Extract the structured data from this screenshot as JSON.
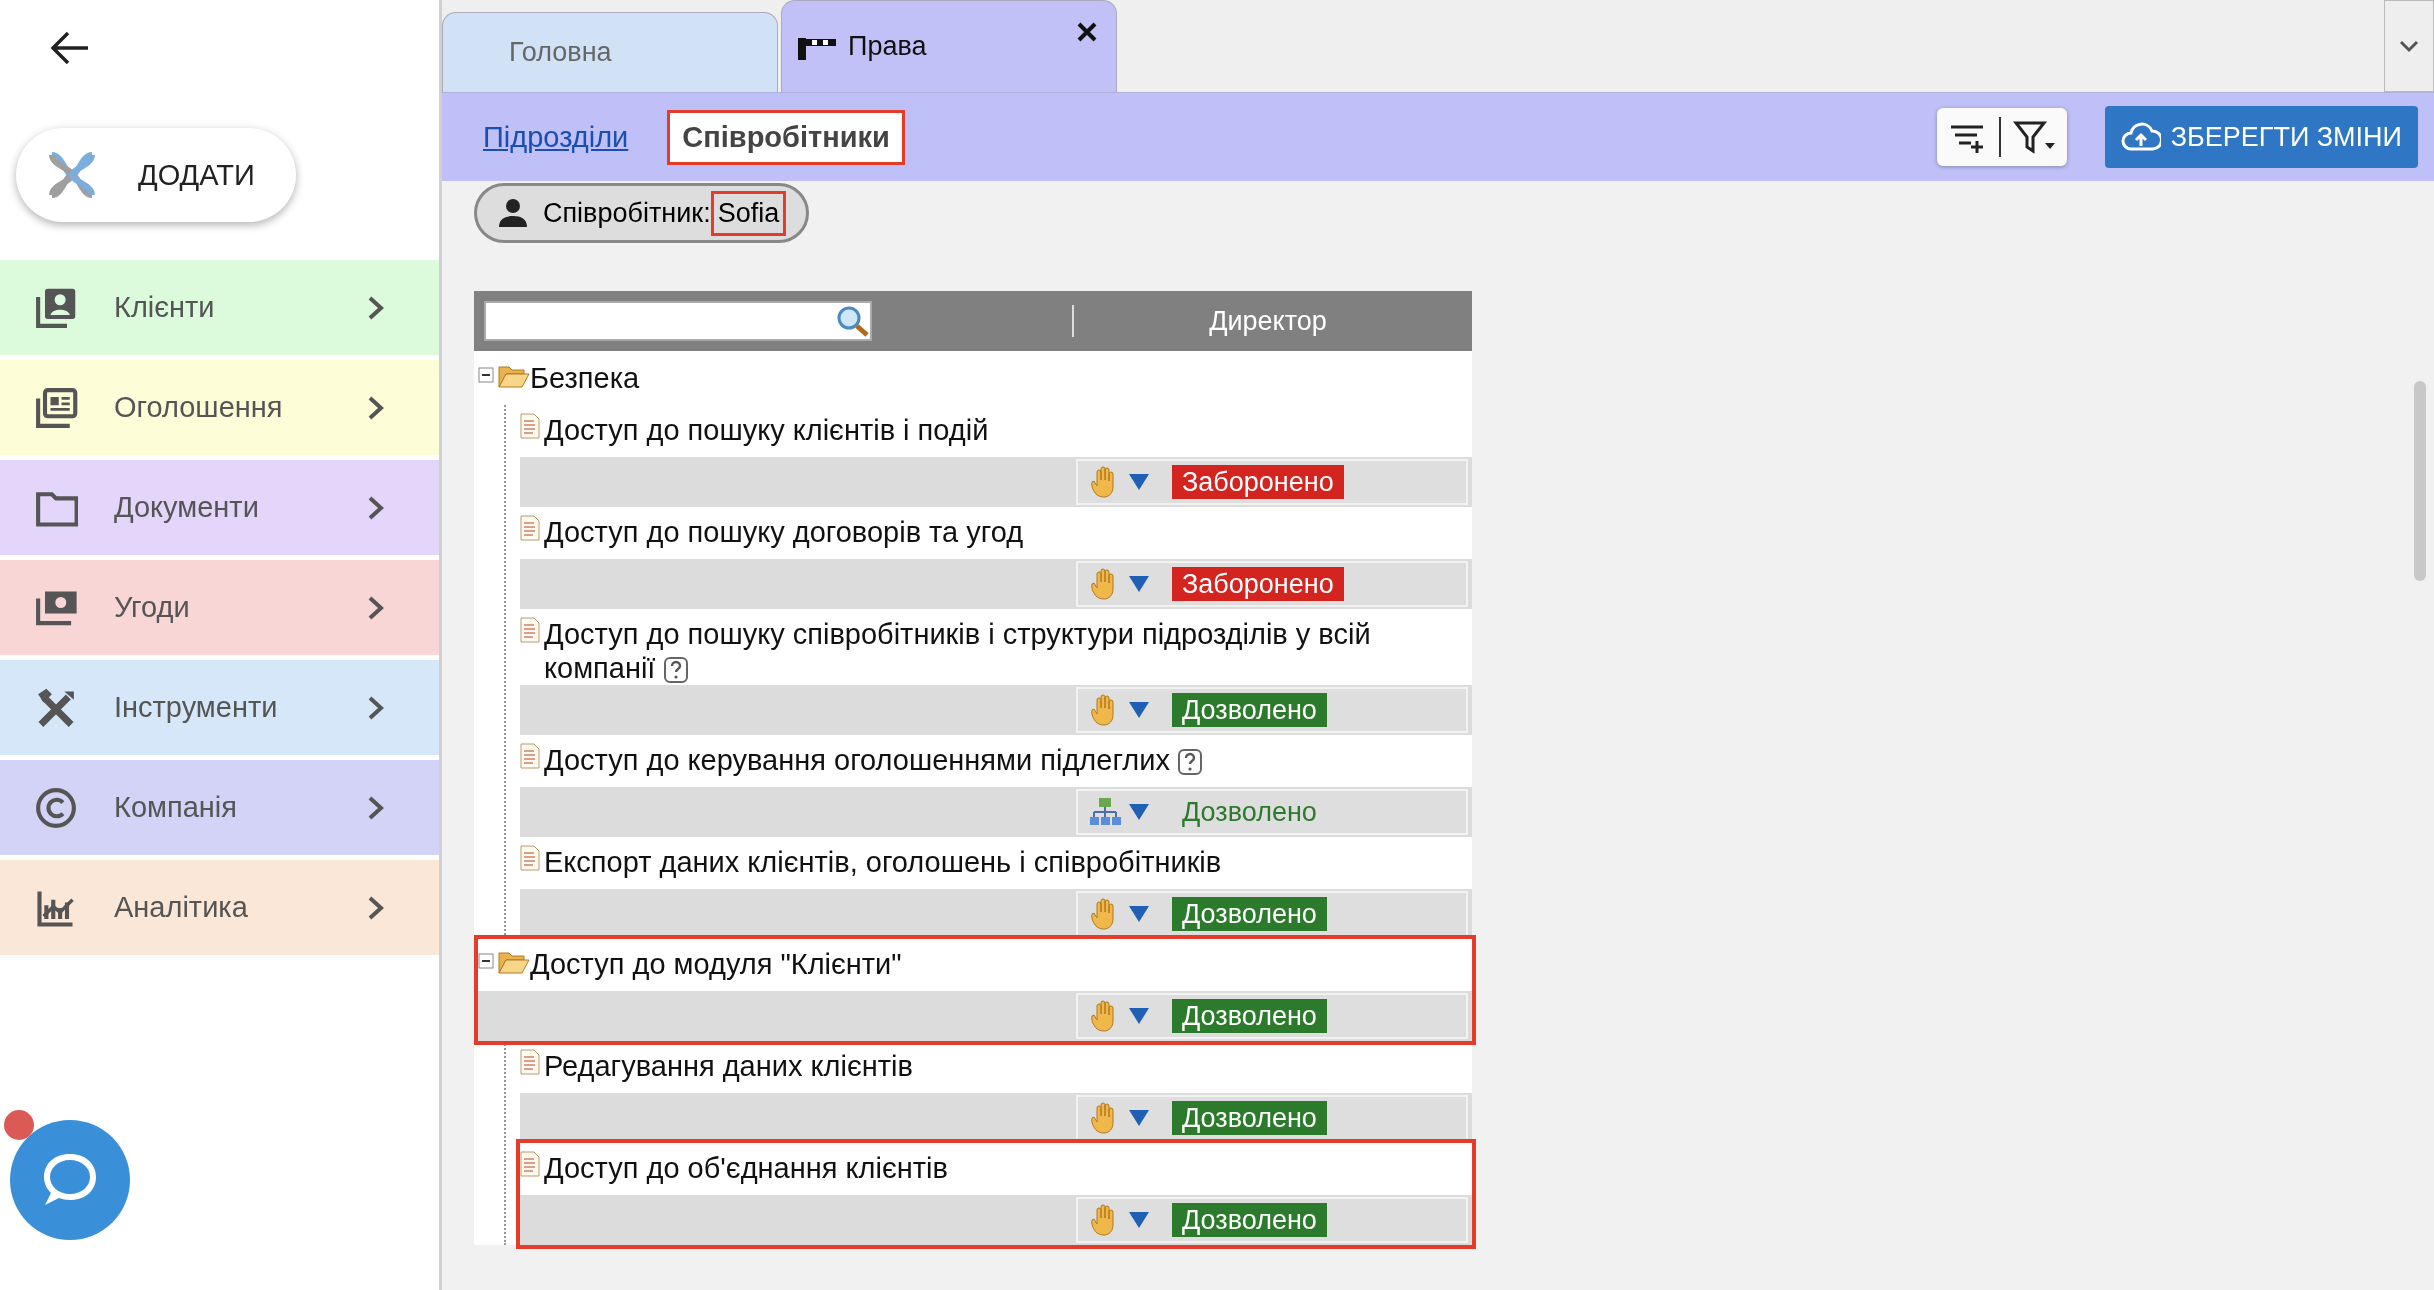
{
  "sidebar": {
    "add_button": {
      "label": "ДОДАТИ"
    },
    "items": [
      {
        "kind": "contacts",
        "label": "Клієнти",
        "color": "#dcfadc"
      },
      {
        "kind": "listings",
        "label": "Оголошення",
        "color": "#fdfdd7"
      },
      {
        "kind": "folder",
        "label": "Документи",
        "color": "#e4d5fb"
      },
      {
        "kind": "money",
        "label": "Угоди",
        "color": "#f8d6d6"
      },
      {
        "kind": "tools",
        "label": "Інструменти",
        "color": "#d7e7fa"
      },
      {
        "kind": "copyright",
        "label": "Компанія",
        "color": "#d3d3f7"
      },
      {
        "kind": "chart",
        "label": "Аналітика",
        "color": "#fbe7d7"
      }
    ],
    "chat": {
      "notification": true
    }
  },
  "tabs": [
    {
      "kind": "plain",
      "label": "Головна",
      "selected": false,
      "closable": false
    },
    {
      "kind": "barrier",
      "label": "Права",
      "selected": true,
      "closable": true
    }
  ],
  "subtabs": [
    {
      "label": "Підрозділи",
      "selected": false,
      "highlighted": false
    },
    {
      "label": "Співробітники",
      "selected": true,
      "highlighted": true
    }
  ],
  "save_button": {
    "label": "ЗБЕРЕГТИ ЗМІНИ"
  },
  "employee": {
    "label": "Співробітник:",
    "value": "Sofia",
    "highlighted": true
  },
  "tree": {
    "column": "Директор",
    "nodes": [
      {
        "label": "Безпека",
        "expanded": true,
        "highlighted": false,
        "children": [
          {
            "label": "Доступ до пошуку клієнтів і подій",
            "help": false,
            "highlighted": false,
            "permission": {
              "inherited": false,
              "allowed": false,
              "label": "Заборонено"
            }
          },
          {
            "label": "Доступ до пошуку договорів та угод",
            "help": false,
            "highlighted": false,
            "permission": {
              "inherited": false,
              "allowed": false,
              "label": "Заборонено"
            }
          },
          {
            "label": "Доступ до пошуку співробітників і структури підрозділів у всій компанії",
            "help": true,
            "highlighted": false,
            "permission": {
              "inherited": false,
              "allowed": true,
              "label": "Дозволено"
            }
          },
          {
            "label": "Доступ до керування оголошеннями підлеглих",
            "help": true,
            "highlighted": false,
            "permission": {
              "inherited": true,
              "allowed": true,
              "label": "Дозволено"
            }
          },
          {
            "label": "Експорт даних клієнтів, оголошень і співробітників",
            "help": false,
            "highlighted": false,
            "permission": {
              "inherited": false,
              "allowed": true,
              "label": "Дозволено"
            }
          }
        ]
      },
      {
        "label": "Доступ до модуля \"Клієнти\"",
        "expanded": true,
        "highlighted": true,
        "permission": {
          "inherited": false,
          "allowed": true,
          "label": "Дозволено"
        },
        "children": [
          {
            "label": "Редагування даних клієнтів",
            "help": false,
            "highlighted": false,
            "permission": {
              "inherited": false,
              "allowed": true,
              "label": "Дозволено"
            }
          },
          {
            "label": "Доступ до об'єднання клієнтів",
            "help": false,
            "highlighted": true,
            "permission": {
              "inherited": false,
              "allowed": true,
              "label": "Дозволено"
            }
          }
        ]
      }
    ]
  }
}
